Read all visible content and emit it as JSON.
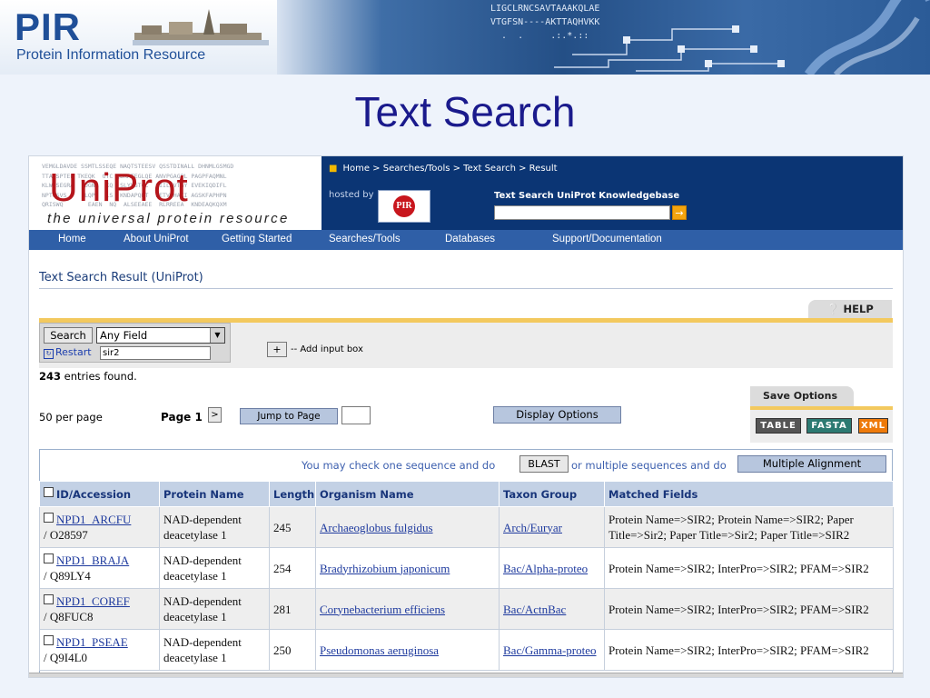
{
  "banner": {
    "org_name": "PIR",
    "org_subtitle": "Protein Information Resource",
    "seq_lines": [
      "LIGCLRNCSAVTAAAKQLAE",
      "VTGFSN----AKTTAQHVKK",
      "  .  .     .:.*.::"
    ]
  },
  "slide": {
    "title": "Text Search"
  },
  "site": {
    "logo_text": "UniProt",
    "logo_tagline": "the universal protein resource",
    "logo_background_text": "VEMGLDAVDE SSMTLSSEQE NAQTSTEESV QSSTDINALL DHNMLGSMGD\nTTAASPTEF TKEQK  GTC QDKATEGLQE ANVPGAGPL PAGPFAQMNL\nKLWHSEGRA   DGNA  KQ  SLYVGTGC  SIILAVTGY EVEKIQDIFL\nNPTGSVS     LQPE  LS  KNDAPQRT  PETVGHAKI AGSKFAPHPN\nQRISWQ       EAEN  NQ  ALSEEAEE  RLRREEA  KNDEAQKQXM",
    "breadcrumb": "Home > Searches/Tools > Text Search > Result",
    "hosted_by": "hosted by",
    "pir_badge": "PIR",
    "quick_search_label": "Text Search UniProt Knowledgebase",
    "quick_search_value": "",
    "quick_go": "→"
  },
  "nav": {
    "items": [
      "Home",
      "About UniProt",
      "Getting Started",
      "Searches/Tools",
      "Databases",
      "Support/Documentation"
    ]
  },
  "page": {
    "result_title": "Text Search Result (UniProt)",
    "help_label": "❔ HELP",
    "search_button": "Search",
    "field_select": "Any Field",
    "restart_label": "Restart",
    "search_term": "sir2",
    "add_button": "+",
    "add_input_label": "-- Add input box",
    "entries_count": "243",
    "entries_suffix": " entries found.",
    "save_options": "Save Options",
    "formats": [
      {
        "label": "TABLE",
        "color": "#555555"
      },
      {
        "label": "FASTA",
        "color": "#2c7a72"
      },
      {
        "label": "XML",
        "color": "#ee7a0a"
      }
    ],
    "per_page": "50 per page",
    "page_label": "Page 1",
    "next_button": ">",
    "jump_button": "Jump to Page",
    "jump_value": "",
    "display_options": "Display Options",
    "check_text": "You may check one sequence and do",
    "blast_button": "BLAST",
    "or_text": "or multiple sequences and do",
    "align_button": "Multiple Alignment"
  },
  "table": {
    "headers": [
      "ID/Accession",
      "Protein Name",
      "Length",
      "Organism Name",
      "Taxon Group",
      "Matched Fields"
    ],
    "rows": [
      {
        "id": "NPD1_ARCFU",
        "acc": "/ O28597",
        "protein": "NAD-dependent deacetylase 1",
        "length": "245",
        "organism": "Archaeoglobus fulgidus",
        "taxon": "Arch/Euryar",
        "matched": "Protein Name=>SIR2; Protein Name=>SIR2; Paper Title=>Sir2; Paper Title=>Sir2; Paper Title=>SIR2"
      },
      {
        "id": "NPD1_BRAJA",
        "acc": "/ Q89LY4",
        "protein": "NAD-dependent deacetylase 1",
        "length": "254",
        "organism": "Bradyrhizobium japonicum",
        "taxon": "Bac/Alpha-proteo",
        "matched": "Protein Name=>SIR2; InterPro=>SIR2; PFAM=>SIR2"
      },
      {
        "id": "NPD1_COREF",
        "acc": "/ Q8FUC8",
        "protein": "NAD-dependent deacetylase 1",
        "length": "281",
        "organism": "Corynebacterium efficiens",
        "taxon": "Bac/ActnBac",
        "matched": "Protein Name=>SIR2; InterPro=>SIR2; PFAM=>SIR2"
      },
      {
        "id": "NPD1_PSEAE",
        "acc": "/ Q9I4L0",
        "protein": "NAD-dependent deacetylase 1",
        "length": "250",
        "organism": "Pseudomonas aeruginosa",
        "taxon": "Bac/Gamma-proteo",
        "matched": "Protein Name=>SIR2; InterPro=>SIR2; PFAM=>SIR2"
      }
    ]
  }
}
